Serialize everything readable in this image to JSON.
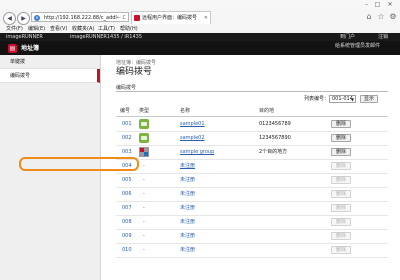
{
  "browser": {
    "url": "http://192.168.222.88/c_addl",
    "url_suffix": "← C",
    "tab_title": "远程用户界面：编码拨号",
    "menu": [
      "文件(F)",
      "编辑(E)",
      "查看(V)",
      "收藏夹(A)",
      "工具(T)",
      "帮助(H)"
    ]
  },
  "header": {
    "device_name": "imageRUNNER",
    "device_info": "imageRUNNER1435 / iR1435",
    "portal_link": "到门户",
    "logout_link": "注销",
    "brand": "地址簿",
    "mail_link": "给系统管理员发邮件"
  },
  "sidebar": {
    "items": [
      {
        "label": "单键拨"
      },
      {
        "label": "编码拨号"
      }
    ]
  },
  "main": {
    "breadcrumb": "地址簿：编码拨号",
    "title": "编码拨号",
    "section_title": "编码拨号",
    "list_label": "列表编号：",
    "list_select": "001-014",
    "display_button": "显示",
    "columns": [
      "编号",
      "类型",
      "名称",
      "目的地"
    ],
    "rows": [
      {
        "num": "001",
        "type": "phone-icon",
        "name": "sample01",
        "dest": "0123456789",
        "action": "删除",
        "enabled": true
      },
      {
        "num": "002",
        "type": "phone-icon",
        "name": "sample02",
        "dest": "1234567890",
        "action": "删除",
        "enabled": true
      },
      {
        "num": "003",
        "type": "group-icon",
        "name": "sample group",
        "dest": "2个目的地方",
        "action": "删除",
        "enabled": true
      },
      {
        "num": "004",
        "type": "-",
        "name": "未注册",
        "dest": "",
        "action": "删除",
        "enabled": false
      },
      {
        "num": "005",
        "type": "-",
        "name": "未注册",
        "dest": "",
        "action": "删除",
        "enabled": false
      },
      {
        "num": "006",
        "type": "-",
        "name": "未注册",
        "dest": "",
        "action": "删除",
        "enabled": false
      },
      {
        "num": "007",
        "type": "-",
        "name": "未注册",
        "dest": "",
        "action": "删除",
        "enabled": false
      },
      {
        "num": "008",
        "type": "-",
        "name": "未注册",
        "dest": "",
        "action": "删除",
        "enabled": false
      },
      {
        "num": "009",
        "type": "-",
        "name": "未注册",
        "dest": "",
        "action": "删除",
        "enabled": false
      },
      {
        "num": "010",
        "type": "-",
        "name": "未注册",
        "dest": "",
        "action": "删除",
        "enabled": false
      }
    ]
  },
  "colors": {
    "accent": "#c8102e",
    "highlight": "#f08c1a",
    "link": "#2a5db0"
  }
}
